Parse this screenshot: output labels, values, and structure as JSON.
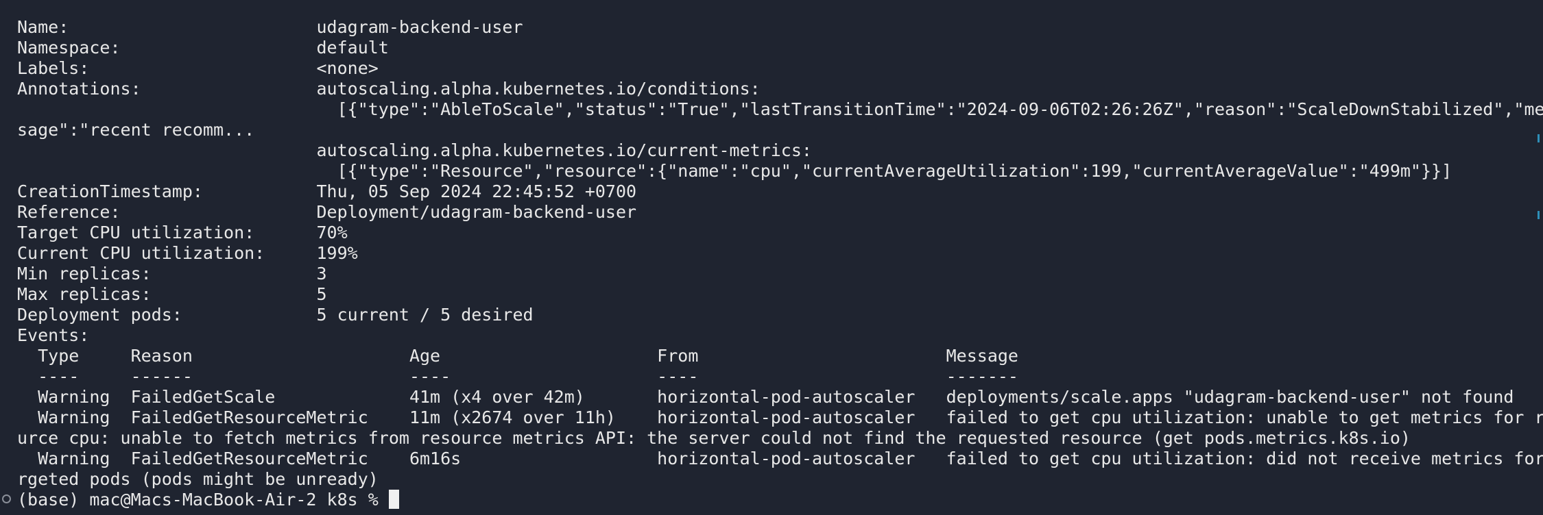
{
  "terminal": {
    "lines": [
      "Name:                        udagram-backend-user",
      "Namespace:                   default",
      "Labels:                      <none>",
      "Annotations:                 autoscaling.alpha.kubernetes.io/conditions:",
      "                               [{\"type\":\"AbleToScale\",\"status\":\"True\",\"lastTransitionTime\":\"2024-09-06T02:26:26Z\",\"reason\":\"ScaleDownStabilized\",\"mes",
      "sage\":\"recent recomm...",
      "                             autoscaling.alpha.kubernetes.io/current-metrics:",
      "                               [{\"type\":\"Resource\",\"resource\":{\"name\":\"cpu\",\"currentAverageUtilization\":199,\"currentAverageValue\":\"499m\"}}]",
      "CreationTimestamp:           Thu, 05 Sep 2024 22:45:52 +0700",
      "Reference:                   Deployment/udagram-backend-user",
      "Target CPU utilization:      70%",
      "Current CPU utilization:     199%",
      "Min replicas:                3",
      "Max replicas:                5",
      "Deployment pods:             5 current / 5 desired",
      "Events:",
      "  Type     Reason                     Age                     From                        Message",
      "  ----     ------                     ----                    ----                        -------",
      "  Warning  FailedGetScale             41m (x4 over 42m)       horizontal-pod-autoscaler   deployments/scale.apps \"udagram-backend-user\" not found",
      "  Warning  FailedGetResourceMetric    11m (x2674 over 11h)    horizontal-pod-autoscaler   failed to get cpu utilization: unable to get metrics for reso",
      "urce cpu: unable to fetch metrics from resource metrics API: the server could not find the requested resource (get pods.metrics.k8s.io)",
      "  Warning  FailedGetResourceMetric    6m16s                   horizontal-pod-autoscaler   failed to get cpu utilization: did not receive metrics for ta",
      "rgeted pods (pods might be unready)"
    ],
    "prompt": "(base) mac@Macs-MacBook-Air-2 k8s % "
  }
}
